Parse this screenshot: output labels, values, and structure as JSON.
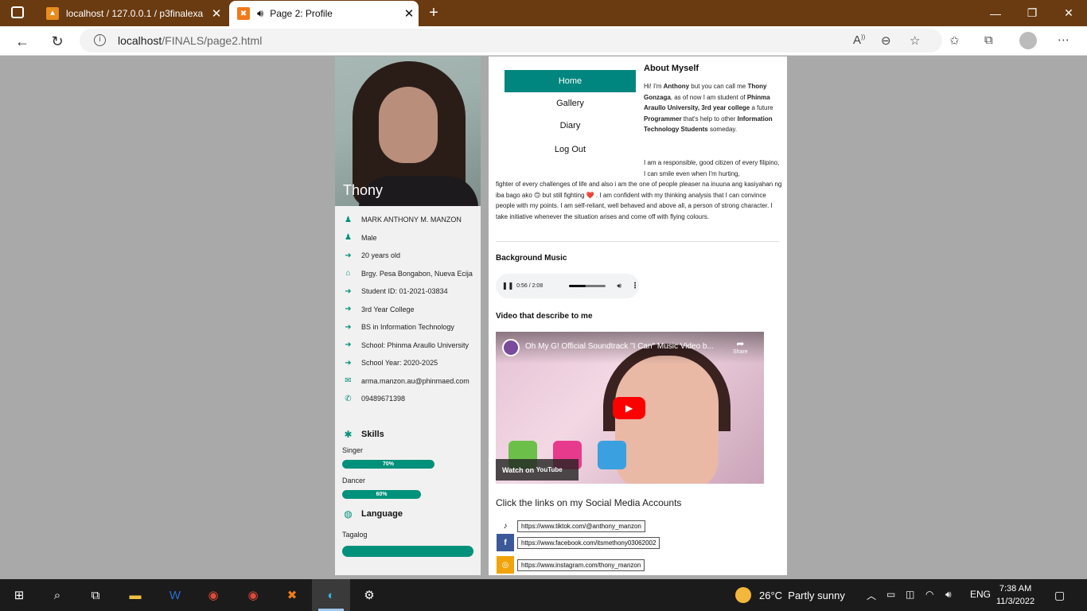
{
  "browser": {
    "tabs": [
      {
        "title": "localhost / 127.0.0.1 / p3finalexa",
        "active": false
      },
      {
        "title": "Page 2: Profile",
        "active": true
      }
    ],
    "url_host": "localhost",
    "url_path": "/FINALS/page2.html",
    "icons": [
      "sidebar-icon",
      "back-icon",
      "refresh-icon",
      "info-icon",
      "read-aloud-icon",
      "zoom-icon",
      "add-favorite-icon",
      "favorites-icon",
      "collections-icon",
      "profile-icon",
      "more-icon"
    ]
  },
  "profile": {
    "display_name": "Thony",
    "info": [
      {
        "icon": "person-icon",
        "text": "MARK ANTHONY M. MANZON"
      },
      {
        "icon": "person-icon",
        "text": "Male"
      },
      {
        "icon": "arrow-icon",
        "text": "20 years old"
      },
      {
        "icon": "home-icon",
        "text": "Brgy. Pesa Bongabon, Nueva Ecija"
      },
      {
        "icon": "arrow-icon",
        "text": "Student ID: 01-2021-03834"
      },
      {
        "icon": "arrow-icon",
        "text": "3rd Year College"
      },
      {
        "icon": "arrow-icon",
        "text": "BS in Information Technology"
      },
      {
        "icon": "arrow-icon",
        "text": "School: Phinma Araullo University"
      },
      {
        "icon": "arrow-icon",
        "text": "School Year: 2020-2025"
      },
      {
        "icon": "mail-icon",
        "text": "arma.manzon.au@phinmaed.com"
      },
      {
        "icon": "phone-icon",
        "text": "09489671398"
      }
    ],
    "skills_title": "Skills",
    "skills": [
      {
        "label": "Singer",
        "percent_text": "70%",
        "percent": 70
      },
      {
        "label": "Dancer",
        "percent_text": "60%",
        "percent": 60
      }
    ],
    "language_title": "Language",
    "languages": [
      {
        "label": "Tagalog",
        "percent_text": "",
        "percent": 100
      }
    ]
  },
  "nav": {
    "items": [
      "Home",
      "Gallery",
      "Diary",
      "Log Out"
    ],
    "active": "Home"
  },
  "about": {
    "title": "About Myself",
    "p1_pre": "Hi! I'm ",
    "p1_name": "Anthony",
    "p1_mid": " but you can call me ",
    "p1_nick": "Thony Gonzaga",
    "p1_mid2": ", as of now I am student of ",
    "p1_school": "Phinma Araullo University, 3rd year college",
    "p1_mid3": " a future ",
    "p1_role": "Programmer",
    "p1_mid4": " that's help to other ",
    "p1_target": "Information Technology Students",
    "p1_end": " someday.",
    "p2_right": "I am a responsible, good citizen of every filipino, I can smile even when I'm hurting,",
    "p2": "fighter of every challenges of life and also i am the one of people pleaser na inuuna ang kasiyahan ng iba bago ako 🙃 but still fighting ❤️ . I am confident with my thinking analysis that I can convince people with my points. I am self-reliant, well behaved and above all, a person of strong character. I take initiative whenever the situation arises and come off with flying colours."
  },
  "music": {
    "title": "Background Music",
    "time": "0:56 / 2:08",
    "progress": 0.44
  },
  "video": {
    "section_title": "Video that describe to me",
    "title": "Oh My G! Official Soundtrack \"I Can\" Music Video b...",
    "share": "Share",
    "watch_on": "Watch on",
    "platform": "YouTube"
  },
  "social": {
    "title": "Click the links on my Social Media Accounts",
    "links": [
      {
        "icon": "tiktok-icon",
        "url": "https://www.tiktok.com/@anthony_manzon",
        "color": "#ffffff"
      },
      {
        "icon": "facebook-icon",
        "url": "https://www.facebook.com/itsmethony03062002",
        "color": "#3b5998"
      },
      {
        "icon": "instagram-icon",
        "url": "https://www.instagram.com/thony_manzon",
        "color": "#f0a30a"
      }
    ]
  },
  "taskbar": {
    "weather_temp": "26°C",
    "weather_text": "Partly sunny",
    "language": "ENG",
    "time": "7:38 AM",
    "date": "11/3/2022"
  },
  "colors": {
    "accent": "#00917a",
    "nav_active": "#00867f",
    "tab_bar": "#6a3a10"
  }
}
